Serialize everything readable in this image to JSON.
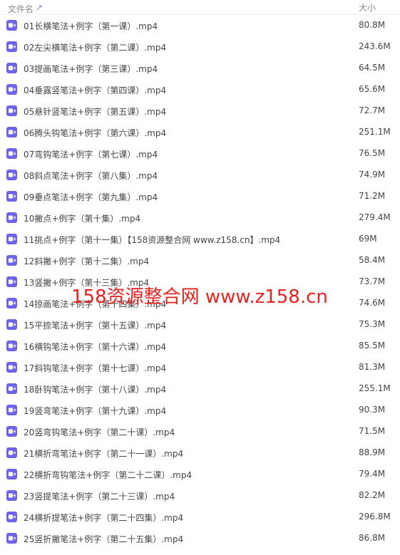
{
  "header": {
    "name_label": "文件名",
    "sort_icon": "arrow-up-icon",
    "size_label": "大小"
  },
  "colors": {
    "video_icon_bg": "#6c63e8",
    "watermark": "#e8211e",
    "sort_arrow": "#4a6ee0"
  },
  "files": [
    {
      "name": "01长横笔法+例字（第一课）.mp4",
      "size": "80.8M"
    },
    {
      "name": "02左尖横笔法+例字（第二课）.mp4",
      "size": "243.6M"
    },
    {
      "name": "03提画笔法+例字（第三课）.mp4",
      "size": "64.5M"
    },
    {
      "name": "04垂露竖笔法+例字（第四课）.mp4",
      "size": "65.6M"
    },
    {
      "name": "05悬针竖笔法+例字（第五课）.mp4",
      "size": "72.7M"
    },
    {
      "name": "06腾头钩笔法+例字（第六课）.mp4",
      "size": "251.1M"
    },
    {
      "name": "07弯钩笔法+例字（第七课）.mp4",
      "size": "76.5M"
    },
    {
      "name": "08斜点笔法+例字（第八集）.mp4",
      "size": "74.9M"
    },
    {
      "name": "09垂点笔法+例字（第九集）.mp4",
      "size": "71.2M"
    },
    {
      "name": "10撇点+例字（第十集）.mp4",
      "size": "279.4M"
    },
    {
      "name": "11挑点+例字（第十一集）【158资源整合网 www.z158.cn】.mp4",
      "size": "69M"
    },
    {
      "name": "12斜撇+例字（第十二集）.mp4",
      "size": "58.4M"
    },
    {
      "name": "13竖撇+例字（第十三集）.mp4",
      "size": "73.7M"
    },
    {
      "name": "14掠画笔法+例字（第十四集）.mp4",
      "size": "74.6M"
    },
    {
      "name": "15平捺笔法+例字（第十五课）.mp4",
      "size": "75.3M"
    },
    {
      "name": "16横钩笔法+例字（第十六课）.mp4",
      "size": "85.5M"
    },
    {
      "name": "17斜钩笔法+例字（第十七课）.mp4",
      "size": "81.3M"
    },
    {
      "name": "18卧钩笔法+例字（第十八课）.mp4",
      "size": "255.1M"
    },
    {
      "name": "19竖弯笔法+例字（第十九课）.mp4",
      "size": "90.3M"
    },
    {
      "name": "20竖弯钩笔法+例字（第二十课）.mp4",
      "size": "71.5M"
    },
    {
      "name": "21横折弯笔法+例字（第二十一课）.mp4",
      "size": "88.9M"
    },
    {
      "name": "22横折弯钩笔法+例字（第二十二课）.mp4",
      "size": "79.4M"
    },
    {
      "name": "23竖提笔法+例字（第二十三课）.mp4",
      "size": "82.2M"
    },
    {
      "name": "24横折提笔法+例字（第二十四集）.mp4",
      "size": "296.8M"
    },
    {
      "name": "25竖折撇笔法+例字（第二十五集）.mp4",
      "size": "86.8M"
    }
  ],
  "file_icon": "video-file-icon",
  "watermark": "158资源整合网 www.z158.cn"
}
